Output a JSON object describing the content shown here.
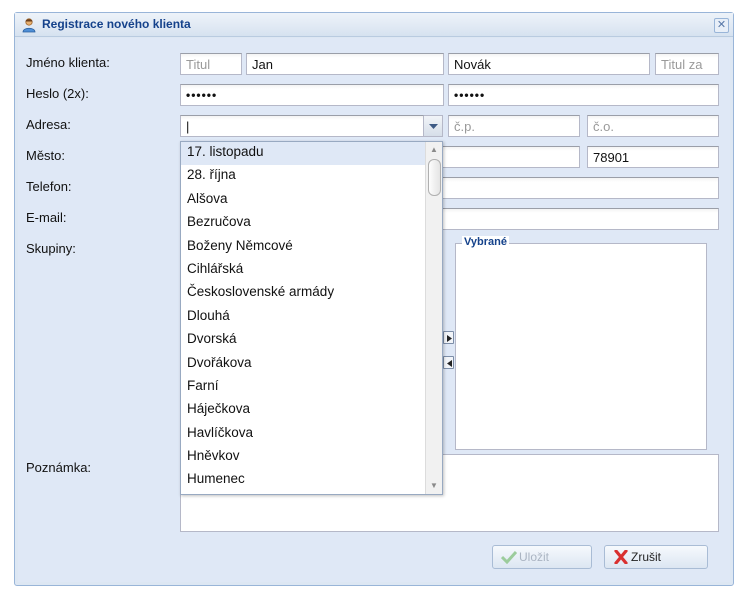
{
  "window": {
    "title": "Registrace nového klienta",
    "close_glyph": "✕",
    "icon": "user-icon",
    "accent_color": "#15428b"
  },
  "labels": {
    "name": "Jméno klienta:",
    "password": "Heslo (2x):",
    "address": "Adresa:",
    "city": "Město:",
    "phone": "Telefon:",
    "email": "E-mail:",
    "groups": "Skupiny:",
    "note": "Poznámka:"
  },
  "fields": {
    "title_before": {
      "value": "",
      "placeholder": "Titul"
    },
    "first_name": {
      "value": "Jan"
    },
    "last_name": {
      "value": "Novák"
    },
    "title_after": {
      "value": "",
      "placeholder": "Titul za"
    },
    "password": {
      "value": "••••••"
    },
    "password_confirm": {
      "value": "••••••"
    },
    "street": {
      "value": "|"
    },
    "house_number": {
      "placeholder": "č.p."
    },
    "orientation_number": {
      "placeholder": "č.o."
    },
    "zip": {
      "value": "78901"
    }
  },
  "groups": {
    "selected_legend": "Vybrané"
  },
  "buttons": {
    "save": {
      "label": "Uložit",
      "icon": "check-icon",
      "enabled": false
    },
    "cancel": {
      "label": "Zrušit",
      "icon": "cross-icon",
      "enabled": true
    }
  },
  "street_dropdown": {
    "items": [
      "17. listopadu",
      "28. října",
      "Alšova",
      "Bezručova",
      "Boženy Němcové",
      "Cihlářská",
      "Československé armády",
      "Dlouhá",
      "Dvorská",
      "Dvořákova",
      "Farní",
      "Háječkova",
      "Havlíčkova",
      "Hněvkov",
      "Humenec"
    ],
    "highlighted_index": 0
  }
}
